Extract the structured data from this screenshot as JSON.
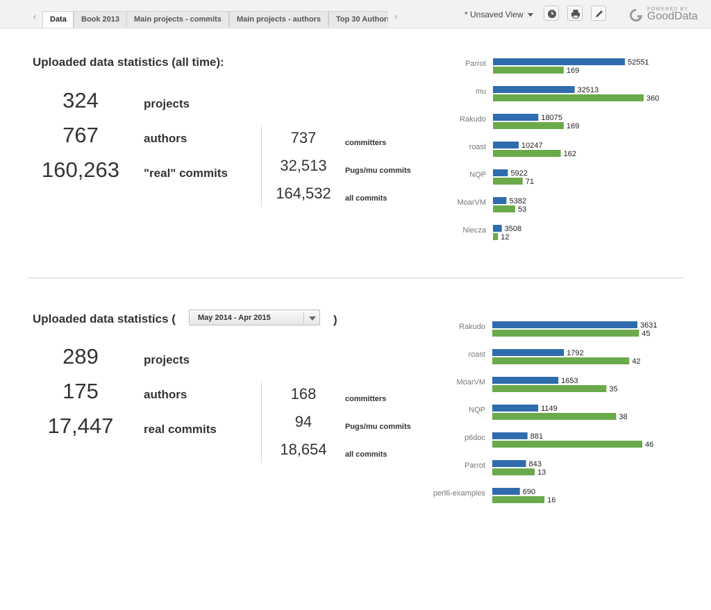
{
  "toolbar": {
    "tabs": [
      "Data",
      "Book 2013",
      "Main projects - commits",
      "Main projects - authors",
      "Top 30 Authors"
    ],
    "active_tab": "Data",
    "view_label": "* Unsaved View",
    "buttons": [
      "clock-icon",
      "printer-icon",
      "pencil-icon"
    ],
    "powered_small": "POWERED BY",
    "powered_brand": "GoodData"
  },
  "section1": {
    "title": "Uploaded data statistics (all time):",
    "projects": "324",
    "projects_label": "projects",
    "authors": "767",
    "authors_label": "authors",
    "commits": "160,263",
    "commits_label": "\"real\" commits",
    "committers": "737",
    "committers_label": "committers",
    "pugs": "32,513",
    "pugs_label": "Pugs/mu commits",
    "all": "164,532",
    "all_label": "all commits"
  },
  "section2": {
    "title": "Uploaded data statistics (",
    "title_close": ")",
    "date_filter": "May 2014 - Apr 2015",
    "projects": "289",
    "projects_label": "projects",
    "authors": "175",
    "authors_label": "authors",
    "commits": "17,447",
    "commits_label": "real commits",
    "committers": "168",
    "committers_label": "committers",
    "pugs": "94",
    "pugs_label": "Pugs/mu commits",
    "all": "18,654",
    "all_label": "all commits"
  },
  "colors": {
    "blue": "#2f6cad",
    "green": "#6aaa4b"
  },
  "chart_data": [
    {
      "type": "bar",
      "orientation": "horizontal",
      "categories": [
        "Parrot",
        "mu",
        "Rakudo",
        "roast",
        "NQP",
        "MoarVM",
        "Niecza"
      ],
      "series": [
        {
          "values": [
            52551,
            32513,
            18075,
            10247,
            5922,
            5382,
            3508
          ]
        },
        {
          "values": [
            169,
            360,
            169,
            162,
            71,
            53,
            12
          ]
        }
      ],
      "legend": "none"
    },
    {
      "type": "bar",
      "orientation": "horizontal",
      "categories": [
        "Rakudo",
        "roast",
        "MoarVM",
        "NQP",
        "p6doc",
        "Parrot",
        "perl6-examples"
      ],
      "series": [
        {
          "values": [
            3631,
            1792,
            1653,
            1149,
            881,
            843,
            690
          ]
        },
        {
          "values": [
            45,
            42,
            35,
            38,
            46,
            13,
            16
          ]
        }
      ],
      "legend": "none"
    }
  ]
}
